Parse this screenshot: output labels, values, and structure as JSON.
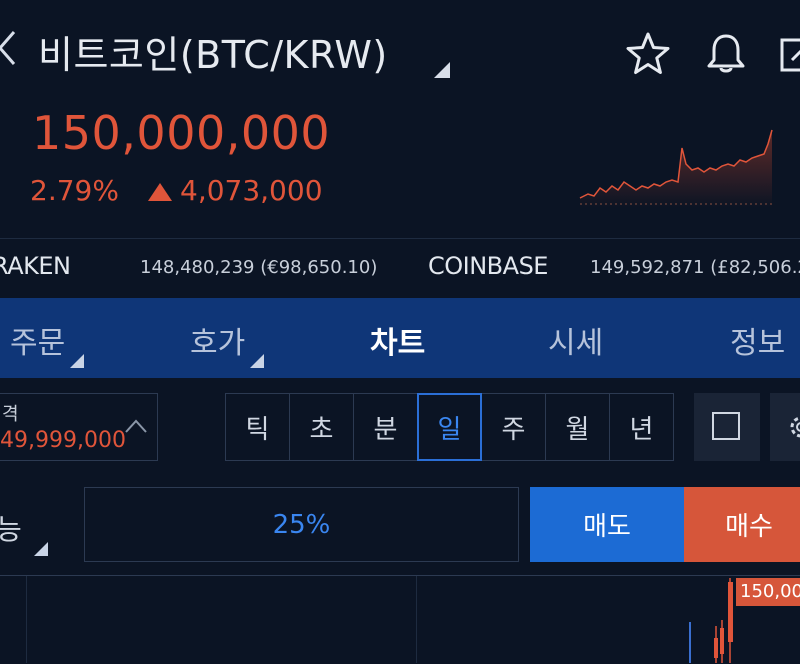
{
  "header": {
    "title": "비트코인(BTC/KRW)",
    "icons": [
      "back-chevron-icon",
      "star-icon",
      "bell-icon",
      "share-icon"
    ]
  },
  "ticker": {
    "price": "150,000,000",
    "change_percent": "2.79%",
    "change_amount": "4,073,000",
    "direction": "up",
    "color_up": "#e0553a"
  },
  "exchanges": [
    {
      "name": "RAKEN",
      "value": "148,480,239 (€98,650.10)"
    },
    {
      "name": "COINBASE",
      "value": "149,592,871 (£82,506.2"
    }
  ],
  "tabs": [
    {
      "label": "주문",
      "active": false
    },
    {
      "label": "호가",
      "active": false
    },
    {
      "label": "차트",
      "active": true
    },
    {
      "label": "시세",
      "active": false
    },
    {
      "label": "정보",
      "active": false
    }
  ],
  "price_input": {
    "label": "격",
    "value": "49,999,000"
  },
  "intervals": [
    {
      "label": "틱",
      "active": false
    },
    {
      "label": "초",
      "active": false
    },
    {
      "label": "분",
      "active": false
    },
    {
      "label": "일",
      "active": true
    },
    {
      "label": "주",
      "active": false
    },
    {
      "label": "월",
      "active": false
    },
    {
      "label": "년",
      "active": false
    }
  ],
  "order": {
    "available_label": "능",
    "percent": "25%",
    "sell_label": "매도",
    "buy_label": "매수"
  },
  "chart": {
    "price_tag": "150,000"
  },
  "colors": {
    "background": "#0b1424",
    "tab_bar": "#0f3678",
    "accent_blue": "#1c6bd4",
    "sell": "#1c6bd4",
    "buy": "#d6563a"
  }
}
